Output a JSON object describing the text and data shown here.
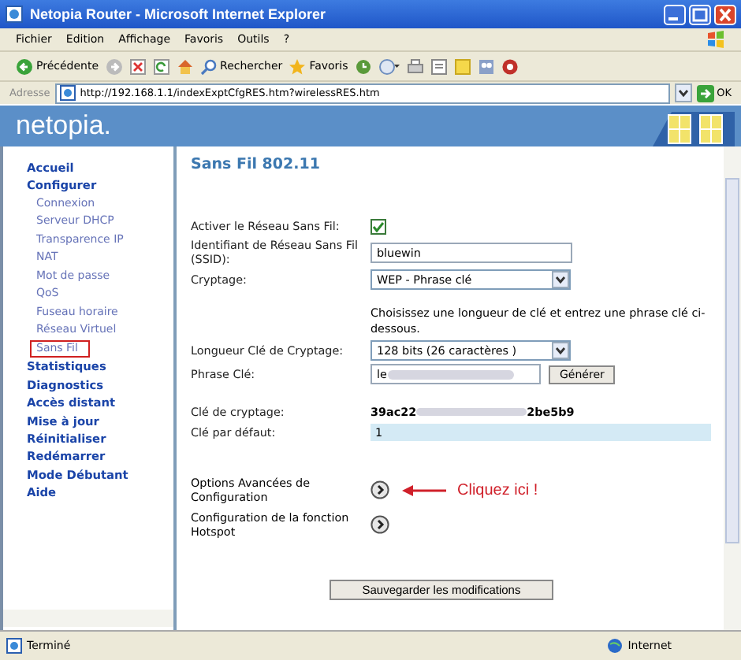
{
  "window": {
    "title": "Netopia Router - Microsoft Internet Explorer"
  },
  "menu": [
    "Fichier",
    "Edition",
    "Affichage",
    "Favoris",
    "Outils",
    "?"
  ],
  "toolbar": {
    "back": "Précédente",
    "search": "Rechercher",
    "favorites": "Favoris"
  },
  "address": {
    "label": "Adresse",
    "url": "http://192.168.1.1/indexExptCfgRES.htm?wirelessRES.htm",
    "go": "OK"
  },
  "banner": {
    "logo": "netopia."
  },
  "sidebar": {
    "items": [
      {
        "label": "Accueil",
        "selected": false
      },
      {
        "label": "Configurer",
        "selected": false,
        "children": [
          {
            "label": "Connexion",
            "selected": false
          },
          {
            "label": "Serveur DHCP",
            "selected": false
          },
          {
            "label": "Transparence IP",
            "selected": false
          },
          {
            "label": "NAT",
            "selected": false
          },
          {
            "label": "Mot de passe",
            "selected": false
          },
          {
            "label": "QoS",
            "selected": false
          },
          {
            "label": "Fuseau horaire",
            "selected": false
          },
          {
            "label": "Réseau Virtuel",
            "selected": false
          },
          {
            "label": "Sans Fil",
            "selected": true
          }
        ]
      },
      {
        "label": "Statistiques",
        "selected": false
      },
      {
        "label": "Diagnostics",
        "selected": false
      },
      {
        "label": "Accès distant",
        "selected": false
      },
      {
        "label": "Mise à jour",
        "selected": false
      },
      {
        "label": "Réinitialiser",
        "selected": false
      },
      {
        "label": "Redémarrer",
        "selected": false
      },
      {
        "label": "Mode Débutant",
        "selected": false
      },
      {
        "label": "Aide",
        "selected": false
      }
    ]
  },
  "form": {
    "title": "Sans Fil 802.11",
    "rows": [
      {
        "kind": "checkbox",
        "label": "Activer le Réseau Sans Fil:",
        "checked": true
      },
      {
        "kind": "text",
        "label": "Identifiant de Réseau Sans Fil (SSID):",
        "value": "bluewin"
      },
      {
        "kind": "select",
        "label": "Cryptage:",
        "value": "WEP - Phrase clé"
      },
      {
        "kind": "note",
        "text": "Choisissez une longueur de clé et entrez une phrase clé ci-dessous."
      },
      {
        "kind": "select",
        "label": "Longueur Clé de Cryptage:",
        "value": "128 bits (26 caractères )"
      },
      {
        "kind": "blurred-text",
        "label": "Phrase Clé:",
        "value": "le",
        "button": "Générer"
      },
      {
        "kind": "blurred-value",
        "label": "Clé de cryptage:",
        "value": "39ac22",
        "value_end": "2be5b9"
      },
      {
        "kind": "highlight",
        "label": "Clé par défaut:",
        "value": "1"
      }
    ],
    "links": [
      {
        "label": "Options Avancées de Configuration",
        "callout": "Cliquez ici !"
      },
      {
        "label": "Configuration de la fonction Hotspot"
      }
    ],
    "save": "Sauvegarder les modifications"
  },
  "status_bar": {
    "text": "Terminé",
    "zone": "Internet"
  }
}
